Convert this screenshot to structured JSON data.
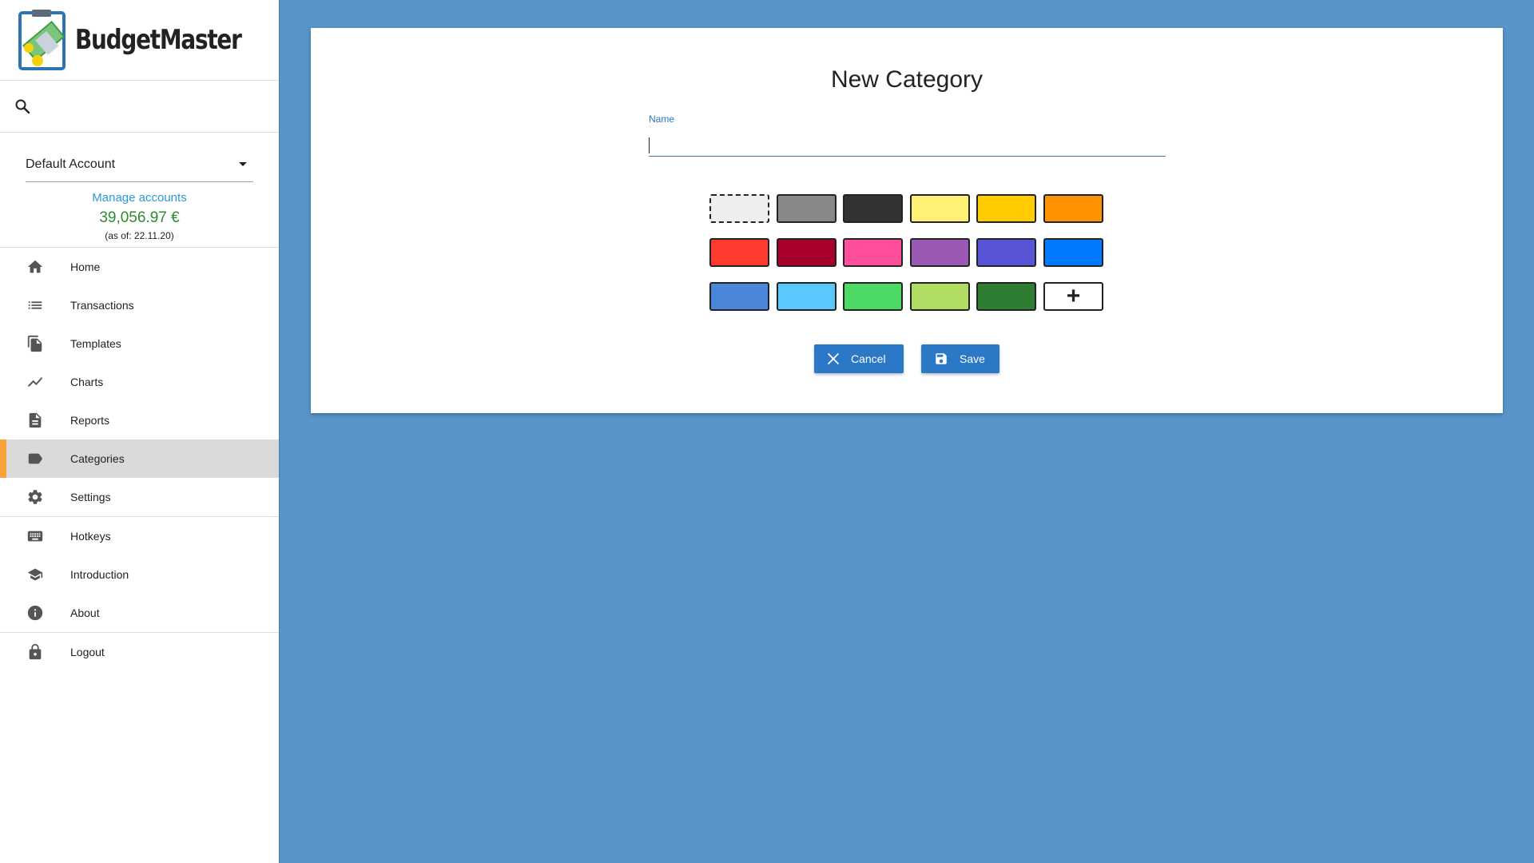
{
  "app": {
    "name": "BudgetMaster"
  },
  "sidebar": {
    "account": {
      "selected": "Default Account",
      "manage_label": "Manage accounts",
      "balance": "39,056.97 €",
      "as_of": "(as of: 22.11.20)"
    },
    "items": [
      {
        "label": "Home",
        "icon": "home-icon"
      },
      {
        "label": "Transactions",
        "icon": "list-icon"
      },
      {
        "label": "Templates",
        "icon": "file-copy-icon"
      },
      {
        "label": "Charts",
        "icon": "chart-line-icon"
      },
      {
        "label": "Reports",
        "icon": "document-icon"
      },
      {
        "label": "Categories",
        "icon": "label-icon",
        "active": true
      },
      {
        "label": "Settings",
        "icon": "gear-icon"
      },
      {
        "label": "Hotkeys",
        "icon": "keyboard-icon"
      },
      {
        "label": "Introduction",
        "icon": "school-icon"
      },
      {
        "label": "About",
        "icon": "info-icon"
      },
      {
        "label": "Logout",
        "icon": "lock-icon"
      }
    ]
  },
  "form": {
    "title": "New Category",
    "name_label": "Name",
    "name_value": "",
    "colors": [
      "#eeeeee",
      "#888888",
      "#333333",
      "#fff176",
      "#ffcc00",
      "#ff9200",
      "#ff3b30",
      "#a6002a",
      "#ff4f9b",
      "#9b59b6",
      "#5856d6",
      "#007aff",
      "#4a86d9",
      "#5ac8fa",
      "#4cd964",
      "#b0dd62",
      "#2e7d32"
    ],
    "selected_color": "#eeeeee",
    "custom_color_symbol": "+",
    "cancel_label": "Cancel",
    "save_label": "Save"
  },
  "theme": {
    "background": "#5794c8",
    "primary": "#2b78c6",
    "active_accent": "#f7a23b",
    "balance_color": "#2e8b2e"
  }
}
